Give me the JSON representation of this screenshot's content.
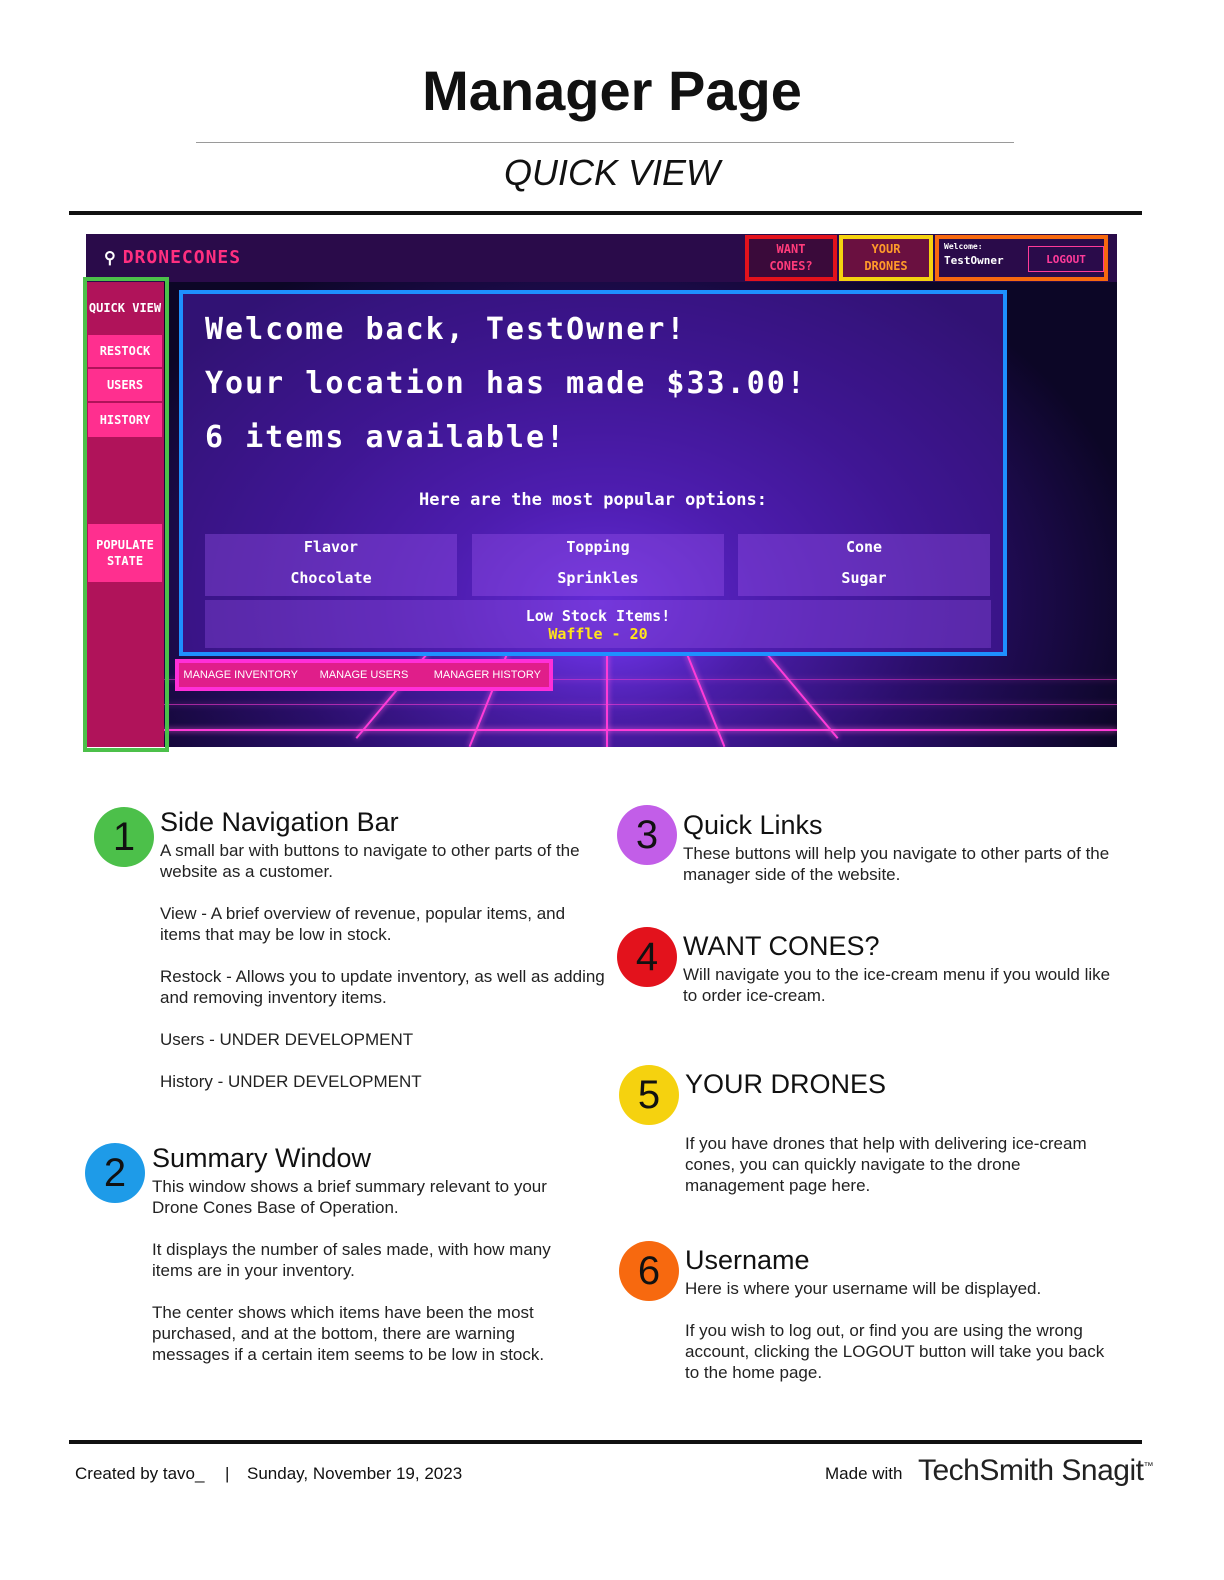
{
  "header": {
    "title": "Manager Page",
    "subtitle": "QUICK VIEW"
  },
  "screenshot": {
    "logo": "DRONECONES",
    "quick_links": {
      "want_cones": "WANT CONES?",
      "your_drones": "YOUR DRONES",
      "welcome_label": "Welcome:",
      "username": "TestOwner",
      "logout": "LOGOUT"
    },
    "sidebar": [
      "QUICK VIEW",
      "RESTOCK",
      "USERS",
      "HISTORY",
      "POPULATE STATE"
    ],
    "summary": {
      "line1": "Welcome back, TestOwner!",
      "line2": "Your location has made $33.00!",
      "line3": "6 items available!",
      "popular_label": "Here are the most popular options:",
      "cards": [
        {
          "heading": "Flavor",
          "value": "Chocolate"
        },
        {
          "heading": "Topping",
          "value": "Sprinkles"
        },
        {
          "heading": "Cone",
          "value": "Sugar"
        }
      ],
      "low_stock_label": "Low Stock Items!",
      "low_stock_item": "Waffle - 20"
    },
    "bottom_buttons": [
      "MANAGE INVENTORY",
      "MANAGE USERS",
      "MANAGER HISTORY"
    ]
  },
  "legend": {
    "side_nav": {
      "number": "1",
      "color": "#4cc04a",
      "title": "Side Navigation Bar",
      "text": "A small bar with buttons to navigate to other parts of the website as a customer.\n\nView - A brief overview of revenue, popular items, and items that may be low in stock.\n\nRestock - Allows you to update inventory, as well as adding and removing inventory items.\n\nUsers - UNDER DEVELOPMENT\n\nHistory - UNDER DEVELOPMENT"
    },
    "summary_window": {
      "number": "2",
      "color": "#1e9be8",
      "title": "Summary Window",
      "text": "This window shows a brief summary relevant to your Drone Cones Base of Operation.\n\nIt displays the number of sales made, with how many items are in your inventory.\n\nThe center shows which items have been the most purchased, and at the bottom, there are warning messages if a certain item seems to be low in stock."
    },
    "quick_links": {
      "number": "3",
      "color": "#c25ee8",
      "title": "Quick Links",
      "text": "These buttons will help you navigate to other parts of the manager side of the website."
    },
    "want_cones": {
      "number": "4",
      "color": "#e3121c",
      "title": "WANT CONES?",
      "text": "Will navigate you to the ice-cream menu if you would like to order ice-cream."
    },
    "your_drones": {
      "number": "5",
      "color": "#f5d20f",
      "title": "YOUR DRONES",
      "text": "If you have drones that help with delivering ice-cream cones, you can quickly navigate to the drone management page here."
    },
    "username": {
      "number": "6",
      "color": "#f7690f",
      "title": "Username",
      "text": "Here is where your username will be displayed.\n\nIf you wish to log out, or find you are using the wrong account, clicking the LOGOUT button will take you back to the home page."
    }
  },
  "footer": {
    "created": "Created by tavo_",
    "separator": "|",
    "date": "Sunday, November 19, 2023",
    "made_with": "Made with",
    "brand": "TechSmith Snagit",
    "tm": "™"
  }
}
